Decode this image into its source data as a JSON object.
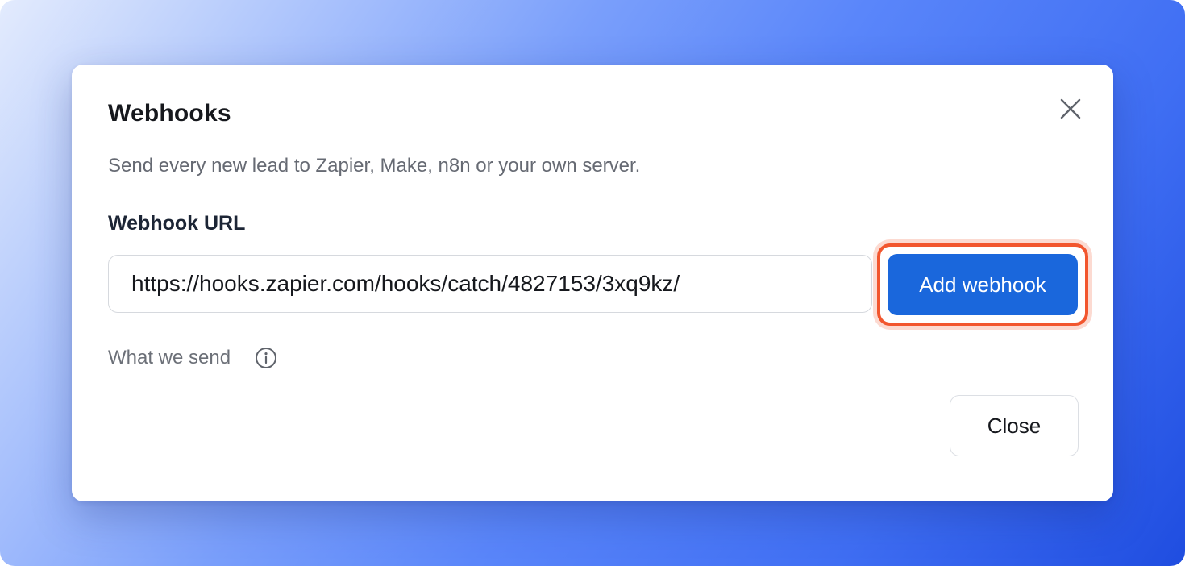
{
  "dialog": {
    "title": "Webhooks",
    "description": "Send every new lead to Zapier, Make, n8n or your own server.",
    "close_icon": "close-icon"
  },
  "webhook_field": {
    "label": "Webhook URL",
    "value": "https://hooks.zapier.com/hooks/catch/4827153/3xq9kz/",
    "placeholder": ""
  },
  "actions": {
    "add_label": "Add webhook",
    "close_label": "Close"
  },
  "info": {
    "label": "What we send",
    "icon": "info-icon"
  },
  "colors": {
    "primary": "#1a67dc",
    "highlight": "#f2562e"
  }
}
